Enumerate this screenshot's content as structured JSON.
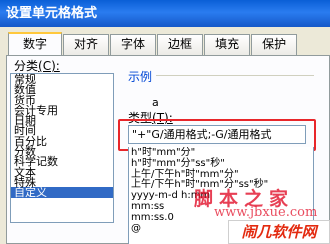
{
  "window": {
    "title": "设置单元格格式"
  },
  "tabs": [
    {
      "label": "数字",
      "active": true
    },
    {
      "label": "对齐",
      "active": false
    },
    {
      "label": "字体",
      "active": false
    },
    {
      "label": "边框",
      "active": false
    },
    {
      "label": "填充",
      "active": false
    },
    {
      "label": "保护",
      "active": false
    }
  ],
  "category": {
    "label": "分类",
    "hotkey": "(C):",
    "items": [
      "常规",
      "数值",
      "货币",
      "会计专用",
      "日期",
      "时间",
      "百分比",
      "分数",
      "科学记数",
      "文本",
      "特殊",
      "自定义"
    ],
    "selected": "自定义"
  },
  "sample": {
    "label": "示例",
    "value": "a"
  },
  "type": {
    "label": "类型",
    "hotkey": "(T):",
    "value": "\"+\"G/通用格式;-G/通用格式"
  },
  "format_list": [
    "h\"时\"mm\"分\"",
    "h\"时\"mm\"分\"ss\"秒\"",
    "上午/下午h\"时\"mm\"分\"",
    "上午/下午h\"时\"mm\"分\"ss\"秒\"",
    "yyyy-m-d h:mm",
    "mm:ss",
    "mm:ss.0",
    "@"
  ],
  "watermark": {
    "line1": "脚本之家",
    "line2": "www.jbxue.com"
  },
  "logo": {
    "text": "闹几软件网"
  }
}
